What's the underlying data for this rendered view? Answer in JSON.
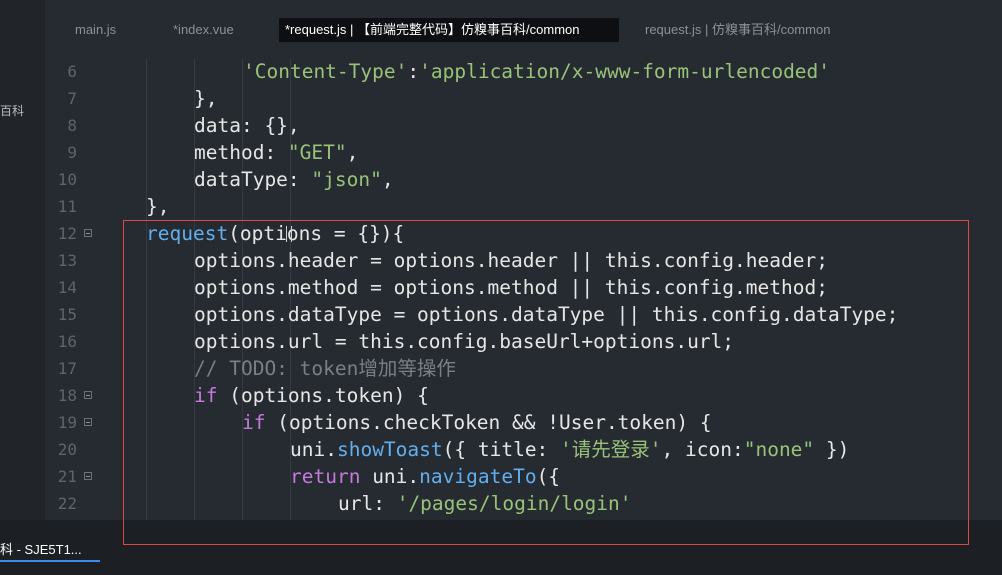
{
  "sidebar": {
    "label": "百科"
  },
  "tabs": [
    {
      "label": "main.js"
    },
    {
      "label": "*index.vue"
    },
    {
      "label": "*request.js | 【前端完整代码】仿糗事百科/common"
    },
    {
      "label": "request.js | 仿糗事百科/common"
    }
  ],
  "gutter": {
    "line_numbers": [
      "6",
      "7",
      "8",
      "9",
      "10",
      "11",
      "12",
      "13",
      "14",
      "15",
      "16",
      "17",
      "18",
      "19",
      "20",
      "21",
      "22"
    ]
  },
  "code": {
    "l6": {
      "str1": "'Content-Type'",
      "colon": ":",
      "str2": "'application/x-www-form-urlencoded'"
    },
    "l7": {
      "text": "},"
    },
    "l8": {
      "text": "data: {},"
    },
    "l9": {
      "key": "method: ",
      "val": "\"GET\"",
      "end": ","
    },
    "l10": {
      "key": "dataType: ",
      "val": "\"json\"",
      "end": ","
    },
    "l11": {
      "text": "},"
    },
    "l12": {
      "fn": "request",
      "rest": "(options = {}){"
    },
    "l13": {
      "text": "options.header = options.header || this.config.header;"
    },
    "l14": {
      "text": "options.method = options.method || this.config.method;"
    },
    "l15": {
      "text": "options.dataType = options.dataType || this.config.dataType;"
    },
    "l16": {
      "text": "options.url = this.config.baseUrl+options.url;"
    },
    "l17": {
      "comment": "// TODO: token增加等操作"
    },
    "l18": {
      "kw": "if",
      "rest": " (options.token) {"
    },
    "l19": {
      "kw": "if",
      "rest": " (options.checkToken && !User.token) {"
    },
    "l20": {
      "a": "uni.",
      "fn": "showToast",
      "b": "({ title: ",
      "s1": "'请先登录'",
      "c": ", icon:",
      "s2": "\"none\"",
      "d": " })"
    },
    "l21": {
      "kw": "return",
      "a": " uni.",
      "fn": "navigateTo",
      "b": "({"
    },
    "l22": {
      "key": "url: ",
      "val": "'/pages/login/login'"
    }
  },
  "taskbar": {
    "label": "科 - SJE5T1..."
  },
  "colors": {
    "background": "#262b31",
    "keyword": "#c678dd",
    "string": "#98c379",
    "function": "#61afef",
    "comment": "#7a7f86",
    "highlight_box": "#e04848",
    "taskbar_accent": "#3b8eea"
  }
}
